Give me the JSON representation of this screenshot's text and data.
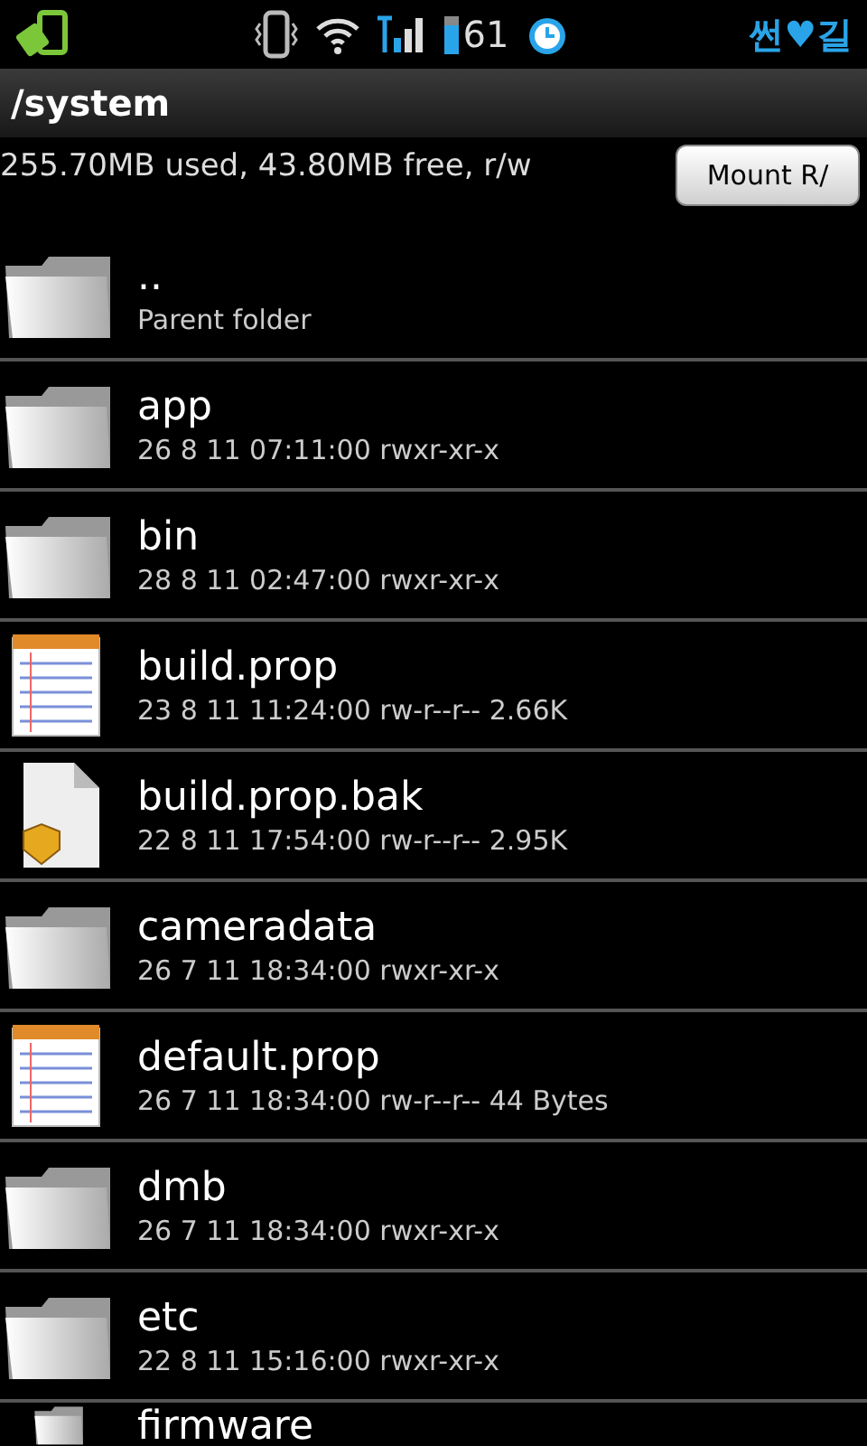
{
  "status_bar": {
    "battery": "61",
    "carrier": "썬♥길"
  },
  "path_bar": {
    "title": "/system"
  },
  "storage": {
    "summary": "255.70MB used, 43.80MB free, r/w",
    "mount_button": "Mount R/"
  },
  "files": [
    {
      "kind": "folder",
      "name": "..",
      "details": "Parent folder"
    },
    {
      "kind": "folder",
      "name": "app",
      "details": "26 8 11 07:11:00 rwxr-xr-x"
    },
    {
      "kind": "folder",
      "name": "bin",
      "details": "28 8 11 02:47:00 rwxr-xr-x"
    },
    {
      "kind": "text",
      "name": "build.prop",
      "details": "23 8 11 11:24:00 rw-r--r-- 2.66K"
    },
    {
      "kind": "file",
      "name": "build.prop.bak",
      "details": "22 8 11 17:54:00 rw-r--r-- 2.95K"
    },
    {
      "kind": "folder",
      "name": "cameradata",
      "details": "26 7 11 18:34:00 rwxr-xr-x"
    },
    {
      "kind": "text",
      "name": "default.prop",
      "details": "26 7 11 18:34:00 rw-r--r-- 44 Bytes"
    },
    {
      "kind": "folder",
      "name": "dmb",
      "details": "26 7 11 18:34:00 rwxr-xr-x"
    },
    {
      "kind": "folder",
      "name": "etc",
      "details": "22 8 11 15:16:00 rwxr-xr-x"
    },
    {
      "kind": "folder",
      "name": "firmware"
    }
  ]
}
